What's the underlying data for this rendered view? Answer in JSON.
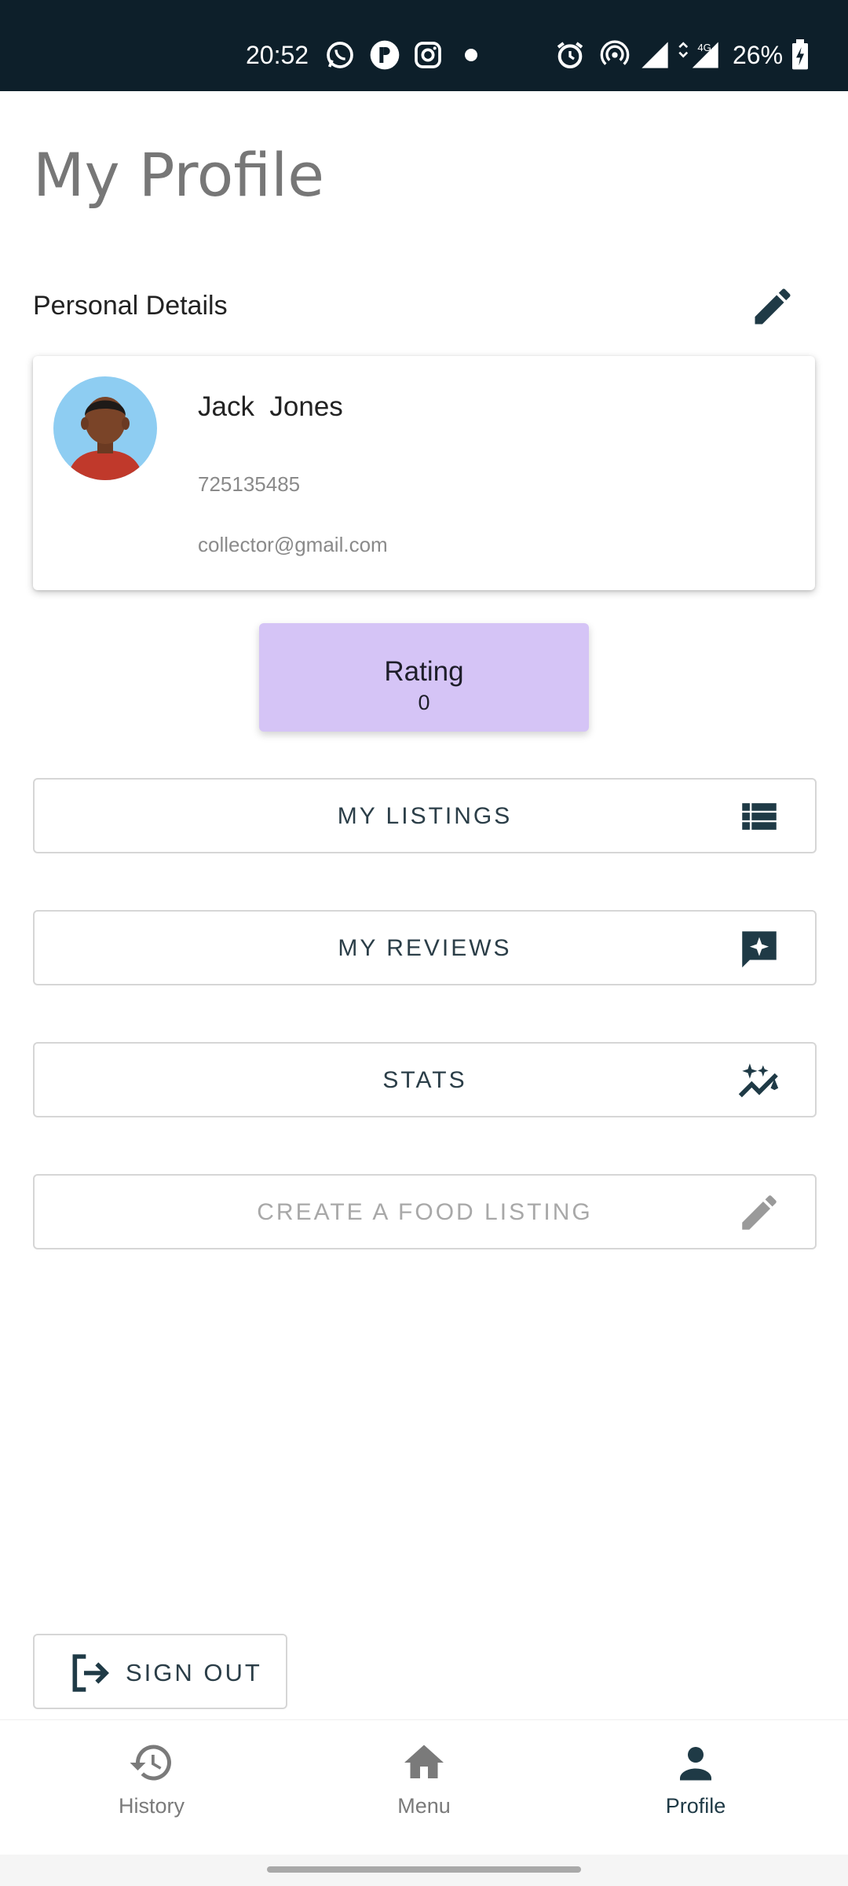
{
  "status_bar": {
    "time": "20:52",
    "battery": "26%",
    "icons": [
      "whatsapp-icon",
      "pinterest-icon",
      "instagram-icon",
      "dot-icon",
      "alarm-icon",
      "hotspot-icon",
      "signal-icon",
      "signal-4g-icon",
      "battery-charging-icon"
    ],
    "network_label": "4G"
  },
  "page": {
    "title": "My Profile",
    "section_title": "Personal Details"
  },
  "profile": {
    "name": "Jack  Jones",
    "phone": "725135485",
    "email": "collector@gmail.com"
  },
  "rating": {
    "label": "Rating",
    "value": "0"
  },
  "actions": {
    "my_listings": "MY LISTINGS",
    "my_reviews": "MY REVIEWS",
    "stats": "STATS",
    "create_listing": "CREATE A FOOD LISTING",
    "sign_out": "SIGN OUT"
  },
  "nav": {
    "items": [
      {
        "label": "History",
        "icon": "history-icon",
        "active": false
      },
      {
        "label": "Menu",
        "icon": "home-icon",
        "active": false
      },
      {
        "label": "Profile",
        "icon": "person-icon",
        "active": true
      }
    ]
  },
  "colors": {
    "status_bar_bg": "#0d1f2a",
    "accent": "#1f3a46",
    "rating_bg": "#d5c4f6",
    "muted_text": "#8a8a8a"
  }
}
